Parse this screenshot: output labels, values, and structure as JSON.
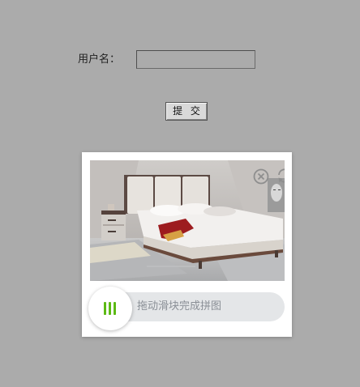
{
  "form": {
    "username_label": "用户名：",
    "username_value": "",
    "submit_label": "提 交"
  },
  "captcha": {
    "close_icon": "close-circle-icon",
    "refresh_icon": "refresh-icon",
    "slider_hint": "拖动滑块完成拼图",
    "slider_handle_icon": "grip-lines-icon",
    "accent_color": "#5cba14"
  }
}
